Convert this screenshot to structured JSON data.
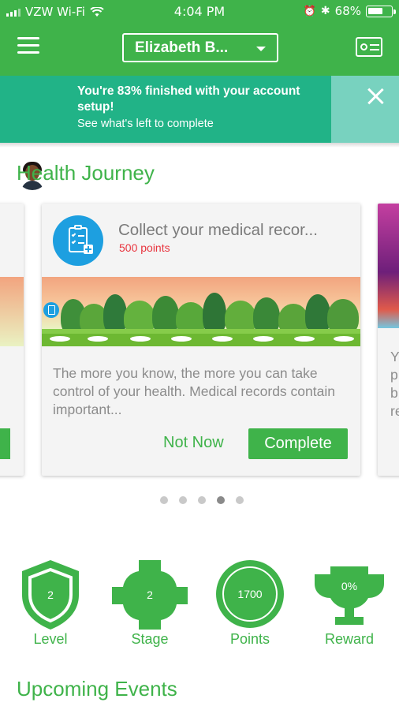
{
  "status_bar": {
    "carrier": "VZW Wi-Fi",
    "time": "4:04 PM",
    "battery": "68%",
    "battery_level": 0.68
  },
  "header": {
    "user_name": "Elizabeth B...",
    "menu_icon": "hamburger-menu-icon",
    "card_icon": "id-card-icon"
  },
  "banner": {
    "message": "You're 83% finished with your account setup!",
    "link": "See what's left to complete",
    "progress_percent": 83
  },
  "health_journey": {
    "title": "Health Journey",
    "card": {
      "title": "Collect your medical recor...",
      "points": "500 points",
      "description": "The more you know, the more you can take control of your health. Medical records contain important...",
      "not_now_label": "Not Now",
      "complete_label": "Complete"
    },
    "next_card_letters": [
      "Y",
      "p",
      "b",
      "re"
    ],
    "pagination": {
      "total": 5,
      "active_index": 3
    }
  },
  "stats": {
    "level": {
      "label": "Level",
      "value": "2"
    },
    "stage": {
      "label": "Stage",
      "value": "2"
    },
    "points": {
      "label": "Points",
      "value": "1700"
    },
    "reward": {
      "label": "Reward",
      "value": "0%"
    }
  },
  "upcoming_events": {
    "title": "Upcoming Events"
  },
  "colors": {
    "brand_green": "#3fb34a",
    "banner_teal": "#21b387",
    "accent_blue": "#1d9fe0",
    "points_red": "#e8343e"
  }
}
